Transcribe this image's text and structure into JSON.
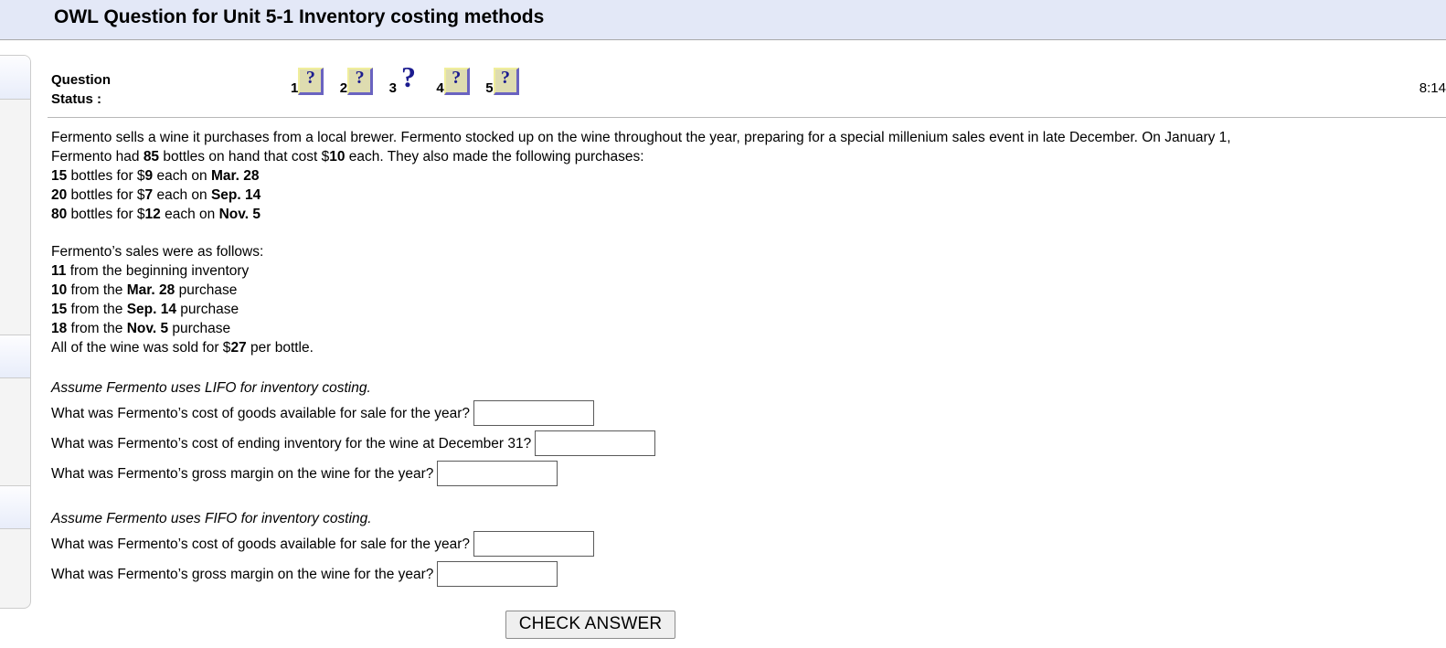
{
  "header": {
    "title": "OWL Question for Unit 5-1 Inventory costing methods"
  },
  "status": {
    "label": "Question\nStatus :",
    "clock": "8:14",
    "items": [
      {
        "number": "1",
        "icon": "question-mark-icon",
        "glyph": "?",
        "style": "box"
      },
      {
        "number": "2",
        "icon": "question-mark-icon",
        "glyph": "?",
        "style": "box"
      },
      {
        "number": "3",
        "icon": "question-mark-icon",
        "glyph": "?",
        "style": "large"
      },
      {
        "number": "4",
        "icon": "question-mark-icon",
        "glyph": "?",
        "style": "box"
      },
      {
        "number": "5",
        "icon": "question-mark-icon",
        "glyph": "?",
        "style": "box"
      }
    ]
  },
  "problem": {
    "intro_line1_a": "Fermento sells a wine it purchases from a local brewer. Fermento stocked up on the wine throughout the year, preparing for a special millenium sales event in late December. On January 1,",
    "intro_line2_a": "Fermento had ",
    "beginning_qty": "85",
    "intro_line2_b": " bottles on hand that cost $",
    "beginning_cost": "10",
    "intro_line2_c": " each. They also made the following purchases:",
    "purchases": [
      {
        "qty": "15",
        "mid": " bottles for $",
        "price": "9",
        "mid2": " each on ",
        "date": "Mar. 28"
      },
      {
        "qty": "20",
        "mid": " bottles for $",
        "price": "7",
        "mid2": " each on ",
        "date": "Sep. 14"
      },
      {
        "qty": "80",
        "mid": " bottles for $",
        "price": "12",
        "mid2": " each on ",
        "date": "Nov. 5"
      }
    ],
    "sales_heading": "Fermento’s sales were as follows:",
    "sales": [
      {
        "qty": "11",
        "mid": " from the beginning inventory",
        "date": "",
        "suffix": ""
      },
      {
        "qty": "10",
        "mid": " from the ",
        "date": "Mar. 28",
        "suffix": " purchase"
      },
      {
        "qty": "15",
        "mid": " from the ",
        "date": "Sep. 14",
        "suffix": " purchase"
      },
      {
        "qty": "18",
        "mid": " from the ",
        "date": "Nov. 5",
        "suffix": " purchase"
      }
    ],
    "sale_price_prefix": "All of the wine was sold for $",
    "sale_price": "27",
    "sale_price_suffix": " per bottle."
  },
  "lifo": {
    "heading": "Assume Fermento uses LIFO for inventory costing.",
    "questions": [
      {
        "text": "What was Fermento’s cost of goods available for sale for the year?",
        "value": "",
        "placeholder": ""
      },
      {
        "text": "What was Fermento’s cost of ending inventory for the wine at December 31?",
        "value": "",
        "placeholder": ""
      },
      {
        "text": "What was Fermento’s gross margin on the wine for the year?",
        "value": "",
        "placeholder": ""
      }
    ]
  },
  "fifo": {
    "heading": "Assume Fermento uses FIFO for inventory costing.",
    "questions": [
      {
        "text": "What was Fermento’s cost of goods available for sale for the year?",
        "value": "",
        "placeholder": ""
      },
      {
        "text": "What was Fermento’s gross margin on the wine for the year?",
        "value": "",
        "placeholder": ""
      }
    ]
  },
  "actions": {
    "check_answer_label": "CHECK ANSWER"
  },
  "colors": {
    "header_bg": "#e3e8f7",
    "icon_fill": "#dedcb0",
    "icon_glyph": "#1b1b8f",
    "icon_shadow": "#6a63c0",
    "button_bg": "#efefef"
  }
}
